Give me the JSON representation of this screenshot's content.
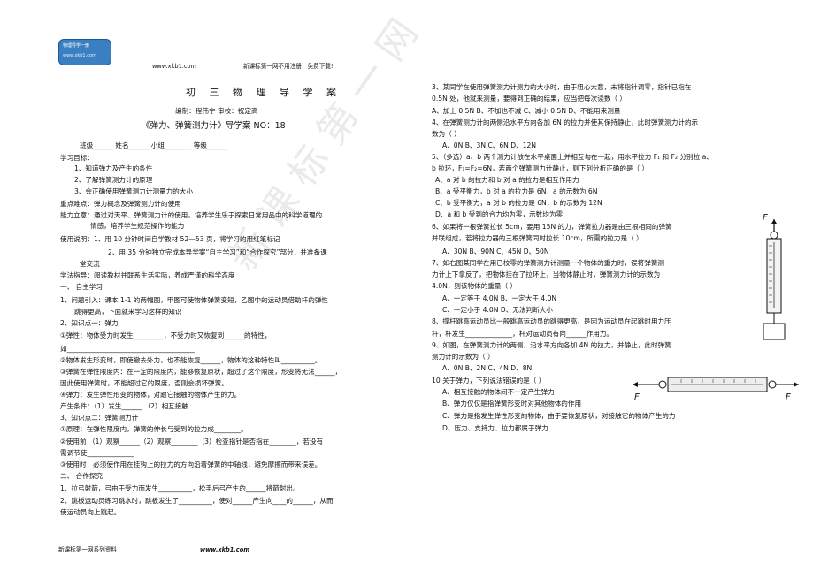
{
  "header": {
    "logo_line1": "物理导学一册",
    "logo_line2": "www.xkb1.com",
    "site_left": "www.xkb1.com",
    "site_note": "新课标第一网不用注册，免费下载!"
  },
  "doc": {
    "title": "初 三 物 理 导 学 案",
    "authors": "编制：程伟宁      审校：祝定高",
    "subtitle": "《弹力、弹簧测力计》导学案      NO：18",
    "student_info": "班级______   姓名______  小组________   等级______",
    "goals_label": "学习目标：",
    "goals": [
      "1、知道弹力及产生的条件",
      "2、了解弹簧测力计的原理",
      "3、会正确使用弹簧测力计测量力的大小"
    ],
    "key_points": "重点难点：弹力概念及弹簧测力计的使用",
    "ability_1": "能力立意：通过对天平、弹簧测力计的使用，培养学生乐于探索日常用品中的科学道理的",
    "ability_2": "情感，培养学生规范操作的能力",
    "usage_1": "使用说明：1、用 10 分钟时间自学教材 52—53 页，将学习的用红笔标记",
    "usage_2": "2、用 35 分钟独立完成本导学案“自主学习”和“合作探究”部分，并准备课",
    "usage_3": "堂交流",
    "method": "学法指导：阅读教材并联系生活实际，养成严谨的科学态度",
    "section1": "一、    自主学习",
    "s1_1": "1、问题引入：课本 1-1 的两幅图，甲图可使物体弹簧变短，乙图中的运动员借助杆的弹性",
    "s1_2": "跳得更高，下面就来学习这样的知识",
    "s1_3": "2、知识点一：弹力",
    "s1_4": "①弹性：物体受力时发生_________，不受力时又恢复到______的特性，",
    "s1_5": "如______________________________________",
    "s1_6": "②物体发生形变时，即使撤去外力，也不能恢复______，物体的这种特性叫__________。",
    "s1_7": "③弹簧在弹性限度内：在一定的限度内，能够恢复原状，超过了这个限度，形变将无法______，",
    "s1_8": "因此使用弹簧时，不能超过它的限度，否则会损坏弹簧。",
    "s1_9": "④弹力：发生弹性形变的物体，对跟它接触的物体产生的力。",
    "s1_10": "产生条件：（1）发生______   （2）相互接触",
    "s1_11": "3、知识点二：弹簧测力计",
    "s1_12": "①原理：在弹性限度内，弹簧的伸长与受到的拉力成________。",
    "s1_13": "②使用前  （1）观察______（2）观察________（3）检查指针是否指在________，若没有",
    "s1_14": "需调节使______________",
    "s1_15": "③使用时：必须使作用在挂钩上的拉力的方向沿着弹簧的中轴线，避免摩擦而带来误差。",
    "section2": "二、    合作探究",
    "s2_1": "1、拉弓射箭，弓由于受力而发生__________，松手后弓产生的______将箭射出。",
    "s2_2": "2、跳板运动员练习跳水时，跳板发生了__________，使对______产生向____的______，从而",
    "s2_3": "使运动员向上跳起。",
    "right": [
      "3、某同学在使用弹簧测力计测力的大小时，由于粗心大意，未将指针调零，指针已指在",
      "0.5N 处，他就来测量，要得到正确的结果，应当把每次读数（     ）",
      "A、加上 0.5N      B、不加也不减       C、减小 0.5N         D、不能用来测量",
      "4、在弹簧测力计的两侧沿水平方向各加 6N 的拉力并使其保持静止，此时弹簧测力计的示",
      "数为（     ）",
      "A、0N         B、3N         C、6N         D、12N",
      "5、（多选）a、b 两个测力计放在水平桌面上并相互勾在一起，用水平拉力 F₁ 和 F₂ 分别拉 a、",
      "b 拉环，F₁=F₂=6N，若两个弹簧测力计静止，则下列分析正确的是（     ）",
      "A、a 对 b 的拉力和 b 对 a 的拉力是相互作用力",
      "B、a 受平衡力，b 对 a 的拉力是 6N，a 的示数为 6N",
      "C、b 受平衡力，a 对 b 的拉力是 6N，b 的示数为 12N",
      "D、a 和 b 受到的合力均为零，示数均为零",
      "6、如果将一根弹簧拉长 5cm，要用 15N 的力，弹簧拉力器是由三根相同的弹簧",
      "并联组成，若将拉力器的三根弹簧同时拉长 10cm，所需的拉力是（     ）",
      "A、30N         B、90N        C、45N        D、50N",
      "7、如右图某同学在用已校零的弹簧测力计测量一个物体的重力时，误将弹簧测",
      "力计上下拿反了，把物体挂在了拉环上，当物体静止时，弹簧测力计的示数为",
      "4.0N，则该物体的重量（     ）",
      "A、一定等于 4.0N            B、一定大于 4.0N",
      "C、一定小于 4.0N            D、无法判断大小",
      "8、撑杆跳高运动员比一般跳高运动员的跳得更高，是因为运动员在起跳时用力压",
      "杆，杆发生______________，杆对运动员有向______作用力。",
      "9、如图，在弹簧测力计的两侧，沿水平方向各加 4N 的拉力，并静止，此时弹簧",
      "测力计的示数为（     ）",
      "A、0N        B、2N        C、4N        D、8N",
      "10 关于弹力，下列说法错误的是（     ）",
      "A、相互接触的物体间不一定产生弹力",
      "B、弹力仅仅是指弹簧形变时对其他物体的作用",
      "C、弹力是指发生弹性形变的物体，由于要恢复原状，对接触它的物体产生的力",
      "D、压力、支持力、拉力都属于弹力"
    ],
    "fig_F": "F",
    "fig_F_left": "F",
    "fig_F_right": "F"
  },
  "footer": {
    "left": "新课标第一网系列资料",
    "center": "www.xkb1.com"
  },
  "watermark": "新课标第一网"
}
